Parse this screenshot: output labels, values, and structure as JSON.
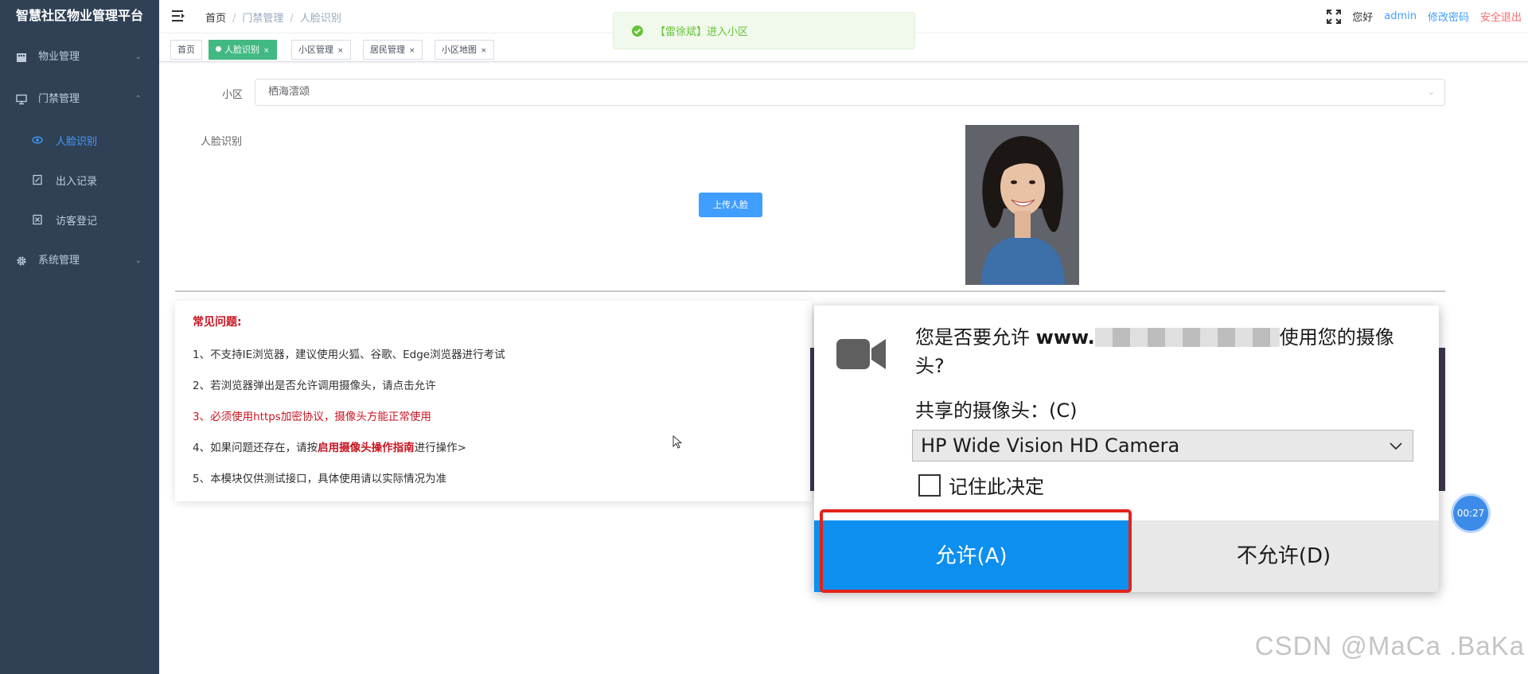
{
  "app": {
    "title": "智慧社区物业管理平台"
  },
  "sidebar": {
    "items": [
      {
        "label": "物业管理",
        "icon": "building-icon",
        "expanded": false
      },
      {
        "label": "门禁管理",
        "icon": "monitor-icon",
        "expanded": true,
        "children": [
          {
            "label": "人脸识别",
            "icon": "eye-icon",
            "active": true
          },
          {
            "label": "出入记录",
            "icon": "edit-icon",
            "active": false
          },
          {
            "label": "访客登记",
            "icon": "visitor-icon",
            "active": false
          }
        ]
      },
      {
        "label": "系统管理",
        "icon": "gear-icon",
        "expanded": false
      }
    ]
  },
  "header": {
    "breadcrumb": [
      "首页",
      "门禁管理",
      "人脸识别"
    ],
    "breadcrumb_sep": "/",
    "greeting": "您好",
    "username": "admin",
    "change_password": "修改密码",
    "logout": "安全退出"
  },
  "tags": [
    {
      "label": "首页",
      "closable": false,
      "active": false
    },
    {
      "label": "人脸识别",
      "closable": true,
      "active": true
    },
    {
      "label": "小区管理",
      "closable": true,
      "active": false
    },
    {
      "label": "居民管理",
      "closable": true,
      "active": false
    },
    {
      "label": "小区地图",
      "closable": true,
      "active": false
    }
  ],
  "tag_close": "×",
  "toast": {
    "message": "【雷徐斌】进入小区",
    "type": "success"
  },
  "form": {
    "community_label": "小区",
    "community_value": "栖海澐颂",
    "face_label": "人脸识别",
    "upload_button": "上传人脸"
  },
  "faq": {
    "title": "常见问题:",
    "line1": "1、不支持IE浏览器，建议使用火狐、谷歌、Edge浏览器进行考试",
    "line2": "2、若浏览器弹出是否允许调用摄像头，请点击允许",
    "line3": "3、必须使用https加密协议，摄像头方能正常使用",
    "line4_prefix": "4、如果问题还存在，请按",
    "line4_link": "启用摄像头操作指南",
    "line4_suffix": "进行操作>",
    "line5": "5、本模块仅供测试接口，具体使用请以实际情况为准"
  },
  "permission_dialog": {
    "question_prefix": "您是否要允许 ",
    "site": "www.",
    "question_suffix": "使用您的摄像头?",
    "camera_label": "共享的摄像头：(C)",
    "camera_value": "HP Wide Vision HD Camera",
    "remember_label": "记住此决定",
    "remember_checked": false,
    "allow_button": "允许(A)",
    "deny_button": "不允许(D)"
  },
  "timer": "00:27",
  "watermark": "CSDN @MaCa .BaKa",
  "colors": {
    "sidebar_bg": "#304156",
    "active_tag": "#42b983",
    "primary": "#409eff",
    "danger": "#c81623",
    "allow_button": "#0d8fef"
  }
}
